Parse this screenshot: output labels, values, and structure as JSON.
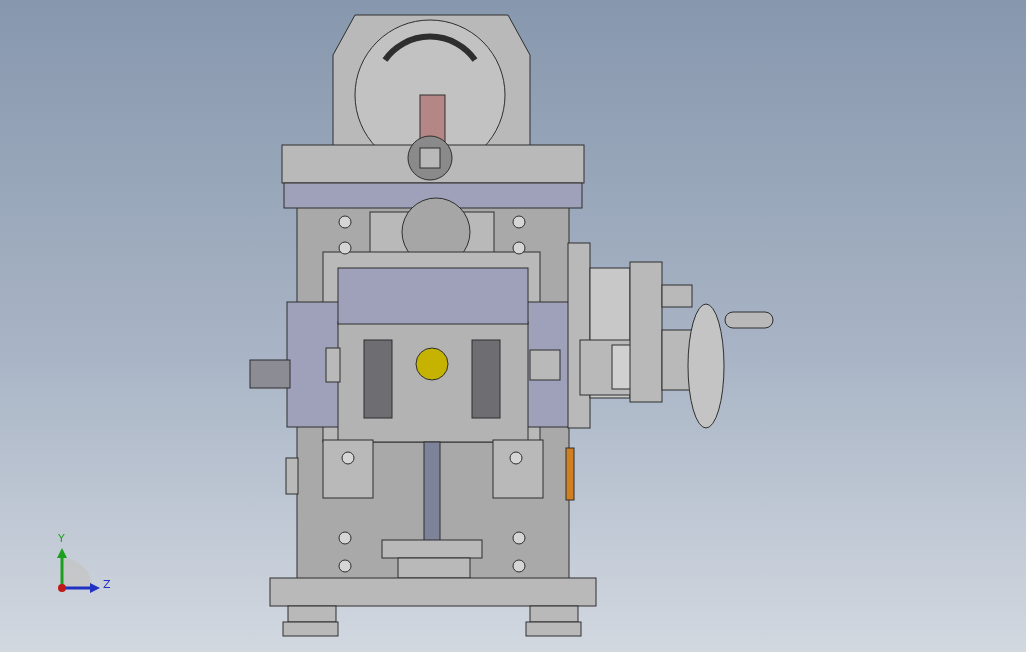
{
  "viewport": {
    "axis_triad": {
      "labels": [
        {
          "kind": "y",
          "text": "Y"
        },
        {
          "kind": "z",
          "text": "Z"
        }
      ]
    }
  }
}
